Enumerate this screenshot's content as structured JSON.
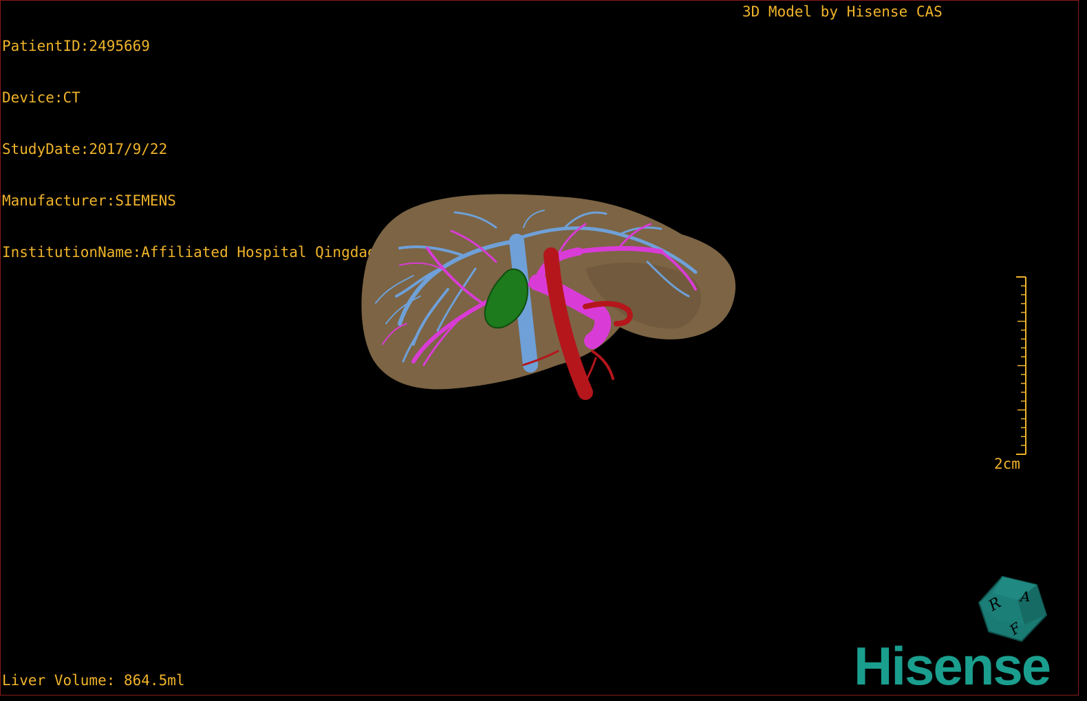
{
  "overlay": {
    "patient_id": "PatientID:2495669",
    "device": "Device:CT",
    "study_date": "StudyDate:2017/9/22",
    "manufacturer": "Manufacturer:SIEMENS",
    "institution": "InstitutionName:Affiliated Hospital Qingdao University-C",
    "brand_caption": "3D Model by Hisense CAS",
    "liver_volume": "Liver Volume: 864.5ml"
  },
  "scale": {
    "label": "2cm"
  },
  "orientation_cube": {
    "faces": [
      "R",
      "A",
      "F"
    ]
  },
  "logo": {
    "text": "Hisense"
  },
  "model_colors": {
    "liver": "#7c6444",
    "hepatic_vein": "#6fa0d8",
    "portal_vein": "#d93cd6",
    "artery_ivc": "#b4161c",
    "tumor": "#1d7a1d"
  },
  "colors": {
    "overlay_text": "#f0b42a",
    "logo": "#1a9e8e",
    "border": "#8a1a1a"
  }
}
